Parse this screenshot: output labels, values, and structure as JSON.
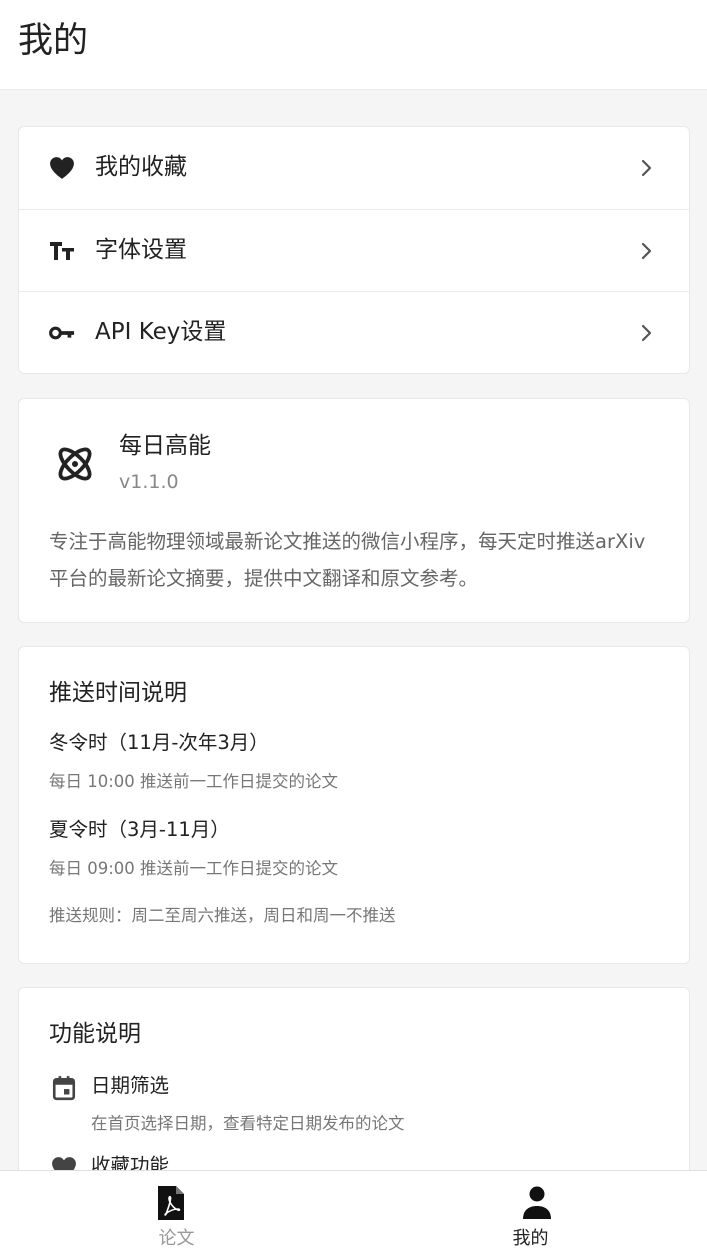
{
  "header": {
    "title": "我的"
  },
  "menu": {
    "items": [
      {
        "label": "我的收藏",
        "icon": "heart-icon"
      },
      {
        "label": "字体设置",
        "icon": "text-size-icon"
      },
      {
        "label": "API Key设置",
        "icon": "key-icon"
      }
    ]
  },
  "about": {
    "app_name": "每日高能",
    "version": "v1.1.0",
    "description": "专注于高能物理领域最新论文推送的微信小程序，每天定时推送arXiv平台的最新论文摘要，提供中文翻译和原文参考。",
    "icon": "atom-icon"
  },
  "push_schedule": {
    "title": "推送时间说明",
    "winter": {
      "title": "冬令时（11月-次年3月）",
      "detail": "每日 10:00 推送前一工作日提交的论文"
    },
    "summer": {
      "title": "夏令时（3月-11月）",
      "detail": "每日 09:00 推送前一工作日提交的论文"
    },
    "rule": "推送规则：周二至周六推送，周日和周一不推送"
  },
  "features": {
    "title": "功能说明",
    "items": [
      {
        "label": "日期筛选",
        "desc": "在首页选择日期，查看特定日期发布的论文",
        "icon": "calendar-icon"
      },
      {
        "label": "收藏功能",
        "desc": "",
        "icon": "heart-icon"
      }
    ]
  },
  "tabbar": {
    "tabs": [
      {
        "label": "论文",
        "icon": "pdf-icon",
        "active": false
      },
      {
        "label": "我的",
        "icon": "person-icon",
        "active": true
      }
    ],
    "active_color": "#222222",
    "inactive_color": "#999999"
  }
}
